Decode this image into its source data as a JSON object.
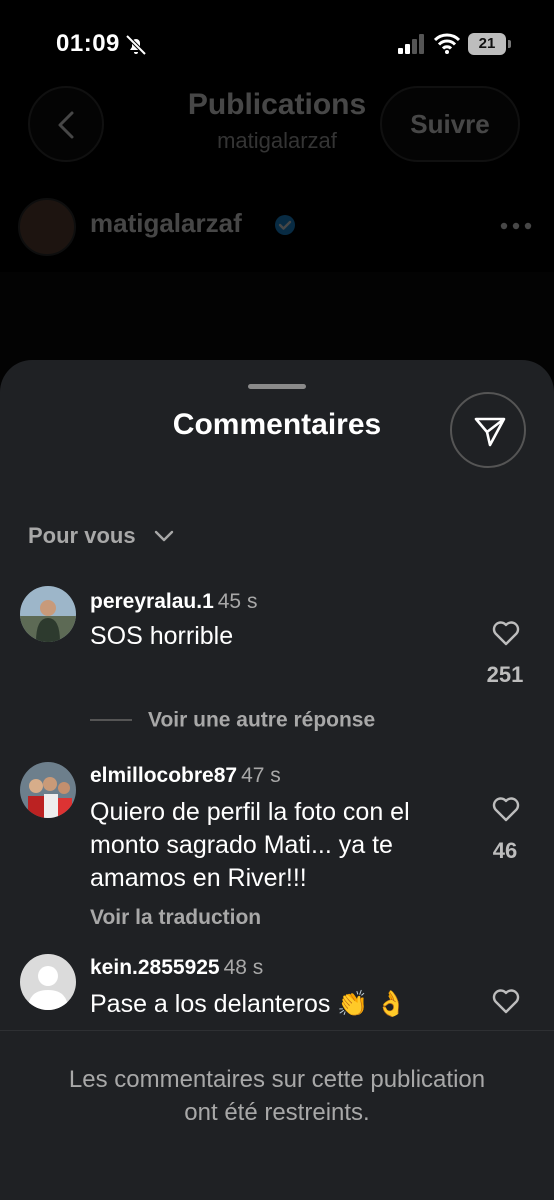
{
  "status_bar": {
    "time": "01:09",
    "battery": "21"
  },
  "header": {
    "title": "Publications",
    "subtitle": "matigalarzaf",
    "follow_label": "Suivre"
  },
  "post": {
    "username": "matigalarzaf",
    "verified": true
  },
  "comments_sheet": {
    "title": "Commentaires",
    "filter_label": "Pour vous",
    "comments": [
      {
        "username": "pereyralau.1",
        "time": "45 s",
        "text": "SOS horrible",
        "likes": "251"
      },
      {
        "username": "elmillocobre87",
        "time": "47 s",
        "text": "Quiero de perfil la foto con el monto sagrado Mati... ya te amamos en River!!!",
        "likes": "46"
      },
      {
        "username": "kein.2855925",
        "time": "48 s",
        "text": "Pase a los delanteros 👏 👌",
        "likes": ""
      }
    ],
    "more_replies_label": "Voir une autre réponse",
    "translate_label": "Voir la traduction",
    "restricted_notice": "Les commentaires sur cette publication ont été restreints."
  },
  "colors": {
    "sheet_background": "#1f2124",
    "verified_badge": "#1d9bf0",
    "secondary_text": "#a8a8a8"
  }
}
